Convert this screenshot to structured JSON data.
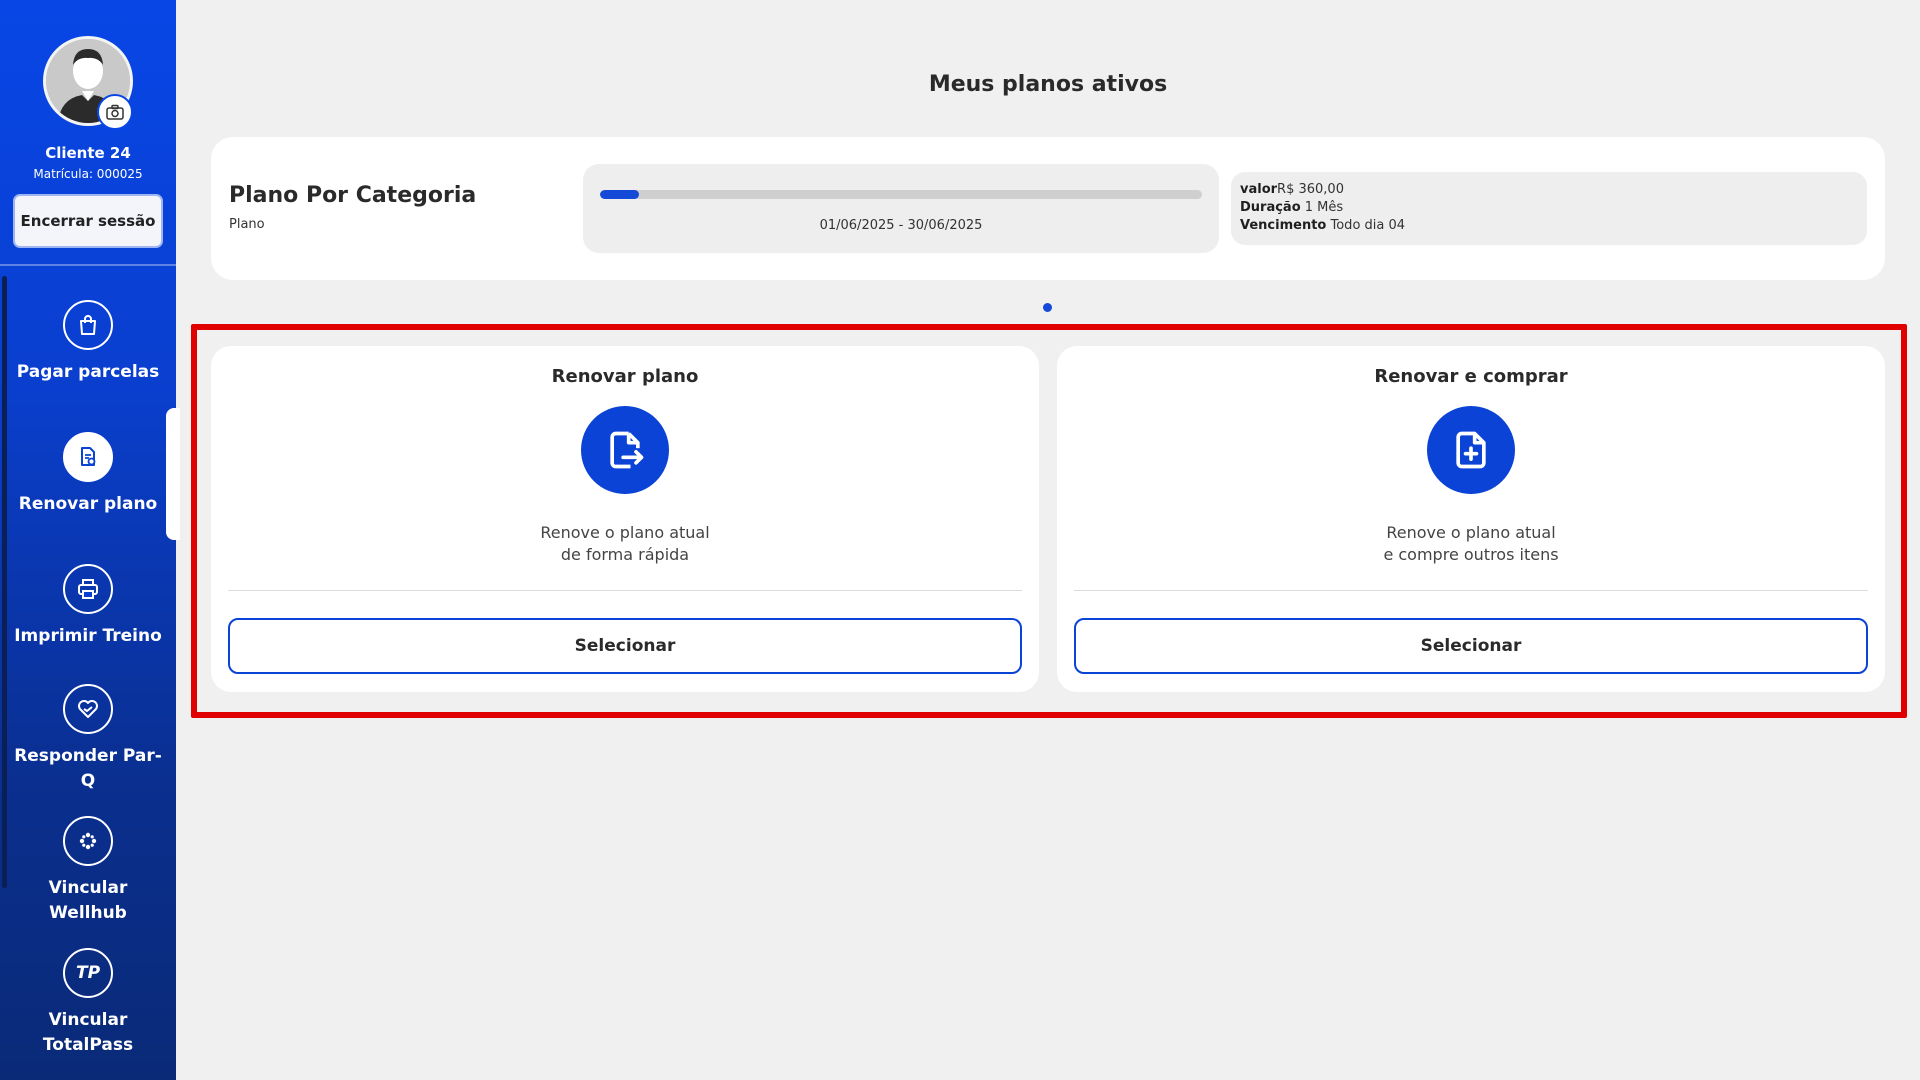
{
  "sidebar": {
    "client_name": "Cliente 24",
    "matricula": "Matrícula: 000025",
    "logout_label": "Encerrar sessão",
    "items": [
      {
        "label": "Pagar parcelas",
        "icon": "shopping-bag-icon"
      },
      {
        "label": "Renovar plano",
        "icon": "document-renew-icon",
        "active": true
      },
      {
        "label": "Imprimir Treino",
        "icon": "printer-icon"
      },
      {
        "label": "Responder Par-Q",
        "icon": "heart-check-icon"
      },
      {
        "label": "Vincular Wellhub",
        "icon": "wellhub-logo-icon"
      },
      {
        "label": "Vincular TotalPass",
        "icon": "totalpass-logo-icon"
      }
    ],
    "totalpass_logo_text": "TP"
  },
  "main": {
    "title": "Meus planos ativos",
    "plan": {
      "name": "Plano Por Categoria",
      "subtitle": "Plano",
      "progress": 0.065,
      "dates": "01/06/2025 - 30/06/2025",
      "valor_label": "valor",
      "valor_value": "R$ 360,00",
      "duracao_label": "Duração",
      "duracao_value": "1 Mês",
      "vencimento_label": "Vencimento",
      "vencimento_value": "Todo dia 04"
    },
    "options": [
      {
        "title": "Renovar plano",
        "icon": "file-export-icon",
        "desc_line1": "Renove o plano atual",
        "desc_line2": "de forma rápida",
        "button_label": "Selecionar"
      },
      {
        "title": "Renovar e comprar",
        "icon": "file-plus-icon",
        "desc_line1": "Renove o plano atual",
        "desc_line2": "e compre outros itens",
        "button_label": "Selecionar"
      }
    ]
  },
  "colors": {
    "accent": "#0a43d6",
    "highlight": "#e00000"
  }
}
